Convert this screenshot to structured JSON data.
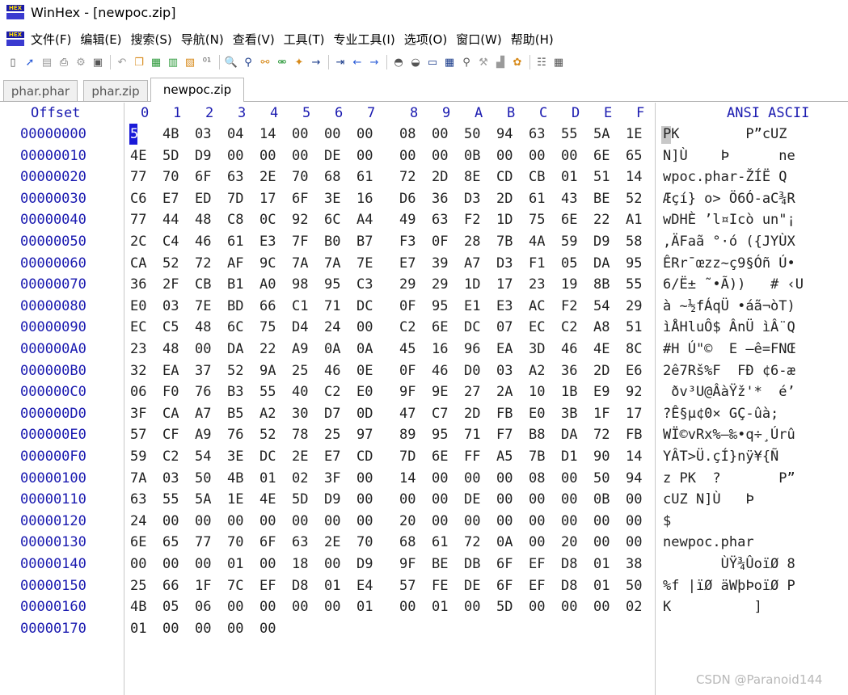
{
  "window": {
    "title": "WinHex - [newpoc.zip]",
    "app_icon_text": "HEX"
  },
  "menu": [
    "文件(F)",
    "编辑(E)",
    "搜索(S)",
    "导航(N)",
    "查看(V)",
    "工具(T)",
    "专业工具(I)",
    "选项(O)",
    "窗口(W)",
    "帮助(H)"
  ],
  "toolbar_icons": [
    "new-file-icon",
    "open-file-icon",
    "save-icon",
    "print-icon",
    "properties-icon",
    "open-folder-icon",
    "undo-icon",
    "copy-icon",
    "paste-icon",
    "clipboard-icon",
    "copy-hex-icon",
    "binary-icon",
    "find-icon",
    "find-hex-icon",
    "replace-icon",
    "replace-hex-icon",
    "find-next-icon",
    "goto-icon",
    "goto-offset-icon",
    "back-icon",
    "forward-icon",
    "disk-icon",
    "disk-edit-icon",
    "ram-icon",
    "calc-icon",
    "search-icon",
    "tools-icon",
    "chart-icon",
    "gear-icon",
    "settings-icon",
    "display-icon"
  ],
  "tabs": [
    "phar.phar",
    "phar.zip",
    "newpoc.zip"
  ],
  "active_tab": 2,
  "header": {
    "offset_label": "Offset",
    "columns": [
      "0",
      "1",
      "2",
      "3",
      "4",
      "5",
      "6",
      "7",
      "8",
      "9",
      "A",
      "B",
      "C",
      "D",
      "E",
      "F"
    ],
    "ascii_label": "ANSI ASCII"
  },
  "rows": [
    {
      "offset": "00000000",
      "bytes": [
        "50",
        "4B",
        "03",
        "04",
        "14",
        "00",
        "00",
        "00",
        "08",
        "00",
        "50",
        "94",
        "63",
        "55",
        "5A",
        "1E"
      ],
      "ascii": "PK        P”cUZ"
    },
    {
      "offset": "00000010",
      "bytes": [
        "4E",
        "5D",
        "D9",
        "00",
        "00",
        "00",
        "DE",
        "00",
        "00",
        "00",
        "0B",
        "00",
        "00",
        "00",
        "6E",
        "65"
      ],
      "ascii": "N]Ù    Þ      ne"
    },
    {
      "offset": "00000020",
      "bytes": [
        "77",
        "70",
        "6F",
        "63",
        "2E",
        "70",
        "68",
        "61",
        "72",
        "2D",
        "8E",
        "CD",
        "CB",
        "01",
        "51",
        "14"
      ],
      "ascii": "wpoc.phar-ŽÍË Q"
    },
    {
      "offset": "00000030",
      "bytes": [
        "C6",
        "E7",
        "ED",
        "7D",
        "17",
        "6F",
        "3E",
        "16",
        "D6",
        "36",
        "D3",
        "2D",
        "61",
        "43",
        "BE",
        "52"
      ],
      "ascii": "Æçí} o> Ö6Ó-aC¾R"
    },
    {
      "offset": "00000040",
      "bytes": [
        "77",
        "44",
        "48",
        "C8",
        "0C",
        "92",
        "6C",
        "A4",
        "49",
        "63",
        "F2",
        "1D",
        "75",
        "6E",
        "22",
        "A1"
      ],
      "ascii": "wDHÈ ’l¤Icò un\"¡"
    },
    {
      "offset": "00000050",
      "bytes": [
        "2C",
        "C4",
        "46",
        "61",
        "E3",
        "7F",
        "B0",
        "B7",
        "F3",
        "0F",
        "28",
        "7B",
        "4A",
        "59",
        "D9",
        "58"
      ],
      "ascii": ",ÄFaã °·ó ({JYÙX"
    },
    {
      "offset": "00000060",
      "bytes": [
        "CA",
        "52",
        "72",
        "AF",
        "9C",
        "7A",
        "7A",
        "7E",
        "E7",
        "39",
        "A7",
        "D3",
        "F1",
        "05",
        "DA",
        "95"
      ],
      "ascii": "ÊRr¯œzz~ç9§Óñ Ú•"
    },
    {
      "offset": "00000070",
      "bytes": [
        "36",
        "2F",
        "CB",
        "B1",
        "A0",
        "98",
        "95",
        "C3",
        "29",
        "29",
        "1D",
        "17",
        "23",
        "19",
        "8B",
        "55"
      ],
      "ascii": "6/Ë± ˜•Ã))   # ‹U"
    },
    {
      "offset": "00000080",
      "bytes": [
        "E0",
        "03",
        "7E",
        "BD",
        "66",
        "C1",
        "71",
        "DC",
        "0F",
        "95",
        "E1",
        "E3",
        "AC",
        "F2",
        "54",
        "29"
      ],
      "ascii": "à ~½fÁqÜ •áã¬òT)"
    },
    {
      "offset": "00000090",
      "bytes": [
        "EC",
        "C5",
        "48",
        "6C",
        "75",
        "D4",
        "24",
        "00",
        "C2",
        "6E",
        "DC",
        "07",
        "EC",
        "C2",
        "A8",
        "51"
      ],
      "ascii": "ìÅHluÔ$ ÂnÜ ìÂ¨Q"
    },
    {
      "offset": "000000A0",
      "bytes": [
        "23",
        "48",
        "00",
        "DA",
        "22",
        "A9",
        "0A",
        "0A",
        "45",
        "16",
        "96",
        "EA",
        "3D",
        "46",
        "4E",
        "8C"
      ],
      "ascii": "#H Ú\"©  E –ê=FNŒ"
    },
    {
      "offset": "000000B0",
      "bytes": [
        "32",
        "EA",
        "37",
        "52",
        "9A",
        "25",
        "46",
        "0E",
        "0F",
        "46",
        "D0",
        "03",
        "A2",
        "36",
        "2D",
        "E6"
      ],
      "ascii": "2ê7Rš%F  FÐ ¢6-æ"
    },
    {
      "offset": "000000C0",
      "bytes": [
        "06",
        "F0",
        "76",
        "B3",
        "55",
        "40",
        "C2",
        "E0",
        "9F",
        "9E",
        "27",
        "2A",
        "10",
        "1B",
        "E9",
        "92"
      ],
      "ascii": " ðv³U@ÂàŸž'*  é’"
    },
    {
      "offset": "000000D0",
      "bytes": [
        "3F",
        "CA",
        "A7",
        "B5",
        "A2",
        "30",
        "D7",
        "0D",
        "47",
        "C7",
        "2D",
        "FB",
        "E0",
        "3B",
        "1F",
        "17"
      ],
      "ascii": "?Ê§µ¢0× GÇ-ûà;"
    },
    {
      "offset": "000000E0",
      "bytes": [
        "57",
        "CF",
        "A9",
        "76",
        "52",
        "78",
        "25",
        "97",
        "89",
        "95",
        "71",
        "F7",
        "B8",
        "DA",
        "72",
        "FB"
      ],
      "ascii": "WÏ©vRx%—‰•q÷¸Úrû"
    },
    {
      "offset": "000000F0",
      "bytes": [
        "59",
        "C2",
        "54",
        "3E",
        "DC",
        "2E",
        "E7",
        "CD",
        "7D",
        "6E",
        "FF",
        "A5",
        "7B",
        "D1",
        "90",
        "14"
      ],
      "ascii": "YÂT>Ü.çÍ}nÿ¥{Ñ"
    },
    {
      "offset": "00000100",
      "bytes": [
        "7A",
        "03",
        "50",
        "4B",
        "01",
        "02",
        "3F",
        "00",
        "14",
        "00",
        "00",
        "00",
        "08",
        "00",
        "50",
        "94"
      ],
      "ascii": "z PK  ?       P”"
    },
    {
      "offset": "00000110",
      "bytes": [
        "63",
        "55",
        "5A",
        "1E",
        "4E",
        "5D",
        "D9",
        "00",
        "00",
        "00",
        "DE",
        "00",
        "00",
        "00",
        "0B",
        "00"
      ],
      "ascii": "cUZ N]Ù   Þ"
    },
    {
      "offset": "00000120",
      "bytes": [
        "24",
        "00",
        "00",
        "00",
        "00",
        "00",
        "00",
        "00",
        "20",
        "00",
        "00",
        "00",
        "00",
        "00",
        "00",
        "00"
      ],
      "ascii": "$"
    },
    {
      "offset": "00000130",
      "bytes": [
        "6E",
        "65",
        "77",
        "70",
        "6F",
        "63",
        "2E",
        "70",
        "68",
        "61",
        "72",
        "0A",
        "00",
        "20",
        "00",
        "00"
      ],
      "ascii": "newpoc.phar"
    },
    {
      "offset": "00000140",
      "bytes": [
        "00",
        "00",
        "00",
        "01",
        "00",
        "18",
        "00",
        "D9",
        "9F",
        "BE",
        "DB",
        "6F",
        "EF",
        "D8",
        "01",
        "38"
      ],
      "ascii": "       ÙŸ¾ÛoïØ 8"
    },
    {
      "offset": "00000150",
      "bytes": [
        "25",
        "66",
        "1F",
        "7C",
        "EF",
        "D8",
        "01",
        "E4",
        "57",
        "FE",
        "DE",
        "6F",
        "EF",
        "D8",
        "01",
        "50"
      ],
      "ascii": "%f |ïØ äWþÞoïØ P"
    },
    {
      "offset": "00000160",
      "bytes": [
        "4B",
        "05",
        "06",
        "00",
        "00",
        "00",
        "00",
        "01",
        "00",
        "01",
        "00",
        "5D",
        "00",
        "00",
        "00",
        "02"
      ],
      "ascii": "K          ]"
    },
    {
      "offset": "00000170",
      "bytes": [
        "01",
        "00",
        "00",
        "00",
        "00"
      ],
      "ascii": ""
    }
  ],
  "watermark": "CSDN @Paranoid144"
}
